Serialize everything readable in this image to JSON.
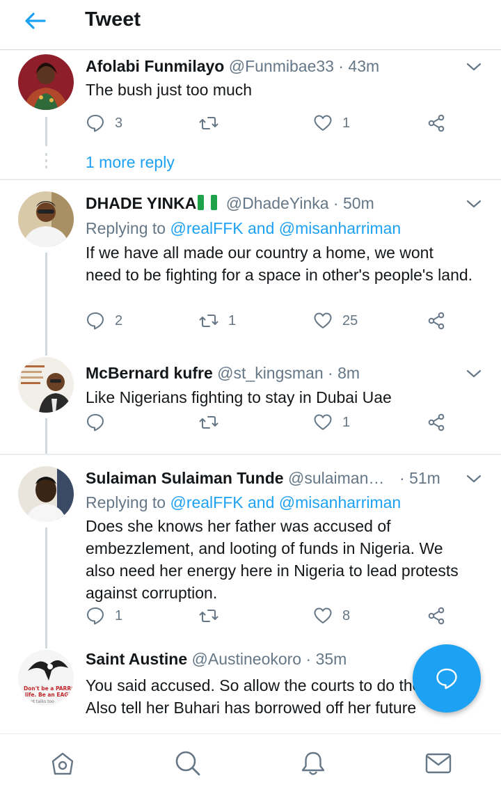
{
  "header": {
    "title": "Tweet"
  },
  "colors": {
    "accent": "#1da1f2",
    "muted": "#657786",
    "divider": "#e6ecf0"
  },
  "tweets": [
    {
      "name": "Afolabi Funmilayo",
      "handle": "@Funmibae33",
      "sep": "·",
      "time": "43m",
      "text": "The bush just too much",
      "reply_count": "3",
      "retweet_count": "",
      "like_count": "1",
      "more_replies": "1 more reply"
    },
    {
      "name": "DHADE YINKA",
      "flag": "Nigeria flag",
      "handle": "@DhadeYinka",
      "sep": "·",
      "time": "50m",
      "replying_prefix": "Replying to",
      "replying_to": "@realFFK and @misanharriman",
      "text": "If we have all made our country a home, we wont need to be fighting for a space in other's people's land.",
      "reply_count": "2",
      "retweet_count": "1",
      "like_count": "25"
    },
    {
      "name": "McBernard kufre",
      "handle": "@st_kingsman",
      "sep": "·",
      "time": "8m",
      "text": "Like Nigerians fighting to stay in Dubai  Uae",
      "reply_count": "",
      "retweet_count": "",
      "like_count": "1"
    },
    {
      "name": "Sulaiman Sulaiman Tunde",
      "handle": "@sulaiman…",
      "sep": "·",
      "time": "51m",
      "replying_prefix": "Replying to",
      "replying_to": "@realFFK and @misanharriman",
      "text": "Does she knows her father was accused of embezzlement, and looting of funds in Nigeria. We also need her energy here in Nigeria to lead protests against corruption.",
      "reply_count": "1",
      "retweet_count": "",
      "like_count": "8"
    },
    {
      "name": "Saint Austine",
      "handle": "@Austineokoro",
      "sep": "·",
      "time": "35m",
      "text": "You said accused. So allow the courts to do their job. Also tell her Buhari has borrowed off her future",
      "avatar_text": [
        "Don't be a PARROT",
        "life. Be an EAGL",
        "ot talks too"
      ]
    }
  ],
  "icons": {
    "back": "arrow-left-icon",
    "chevron": "chevron-down-icon",
    "reply": "reply-bubble-icon",
    "retweet": "retweet-icon",
    "like": "heart-icon",
    "share": "share-icon",
    "compose": "compose-reply-icon",
    "home": "home-icon",
    "search": "search-icon",
    "notifications": "bell-icon",
    "messages": "mail-icon"
  }
}
